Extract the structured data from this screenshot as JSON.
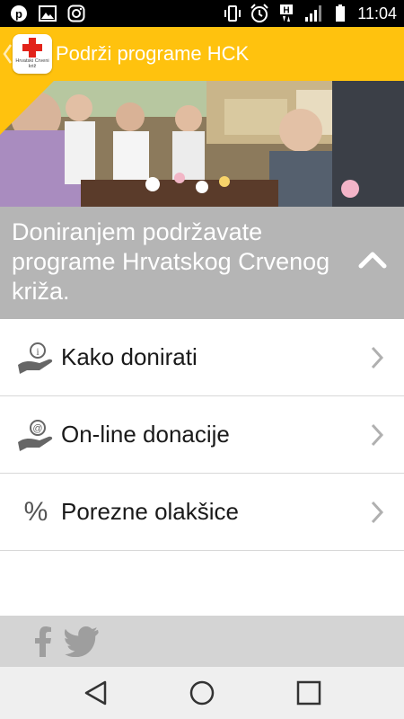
{
  "status_bar": {
    "time": "11:04",
    "left_icons": [
      "pinterest-icon",
      "image-icon",
      "instagram-icon"
    ],
    "right_icons": [
      "vibrate-icon",
      "alarm-icon",
      "data-h-icon",
      "signal-icon",
      "battery-icon"
    ]
  },
  "app_bar": {
    "title": "Podrži programe HCK",
    "logo_text": "Hrvatski Crveni križ",
    "accent": "#ffc20e"
  },
  "banner": {
    "text": "Doniranjem podržavate programe Hrvatskog Crvenog križa.",
    "background": "#b5b5b5"
  },
  "menu": {
    "items": [
      {
        "label": "Kako donirati",
        "icon": "info-hand-icon"
      },
      {
        "label": "On-line donacije",
        "icon": "at-hand-icon"
      },
      {
        "label": "Porezne olakšice",
        "icon": "percent-icon",
        "symbol": "%"
      }
    ]
  },
  "footer": {
    "icons": [
      "facebook-icon",
      "twitter-icon"
    ]
  },
  "nav_bar": {
    "buttons": [
      "back-icon",
      "home-icon",
      "recents-icon"
    ]
  }
}
